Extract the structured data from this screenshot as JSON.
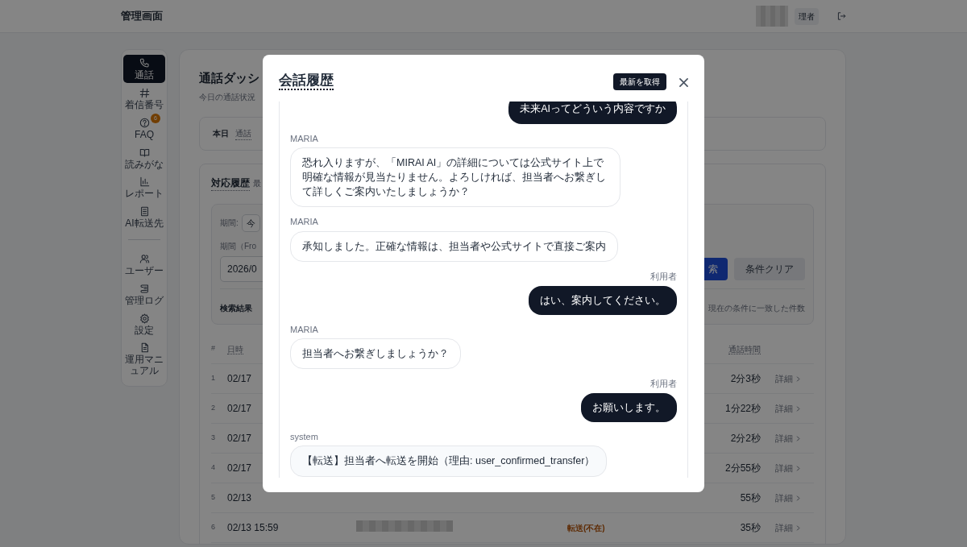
{
  "header": {
    "title": "管理画面",
    "role_badge": "理者"
  },
  "sidebar": {
    "groups": [
      [
        {
          "label": "通話",
          "selected": true
        },
        {
          "label": "着信番号",
          "selected": false
        },
        {
          "label": "FAQ",
          "selected": false,
          "badge": "6"
        },
        {
          "label": "読みがな",
          "selected": false
        },
        {
          "label": "レポート",
          "selected": false
        },
        {
          "label": "AI転送先",
          "selected": false
        }
      ],
      [
        {
          "label": "ユーザー",
          "selected": false
        },
        {
          "label": "管理ログ",
          "selected": false
        },
        {
          "label": "設定",
          "selected": false
        },
        {
          "label": "運用マニュアル",
          "selected": false
        }
      ]
    ]
  },
  "dashboard": {
    "title": "通話ダッシ",
    "subtitle": "今日の通話状況",
    "today": {
      "label": "本日",
      "tab": "通話"
    },
    "history": {
      "title": "対応履歴",
      "note": "最",
      "filter": {
        "period_label": "期間:",
        "period_value": "今",
        "from_label": "期間（Fro",
        "from_value": "2026/0",
        "search_button": "索",
        "clear_button": "条件クリア",
        "result_label": "検索結果",
        "result_note": "現在の条件に一致した件数"
      },
      "table": {
        "columns": [
          "#",
          "日時",
          "通話時間"
        ],
        "rows": [
          {
            "no": "1",
            "datetime": "02/17",
            "duration": "2分3秒",
            "link": "詳細"
          },
          {
            "no": "2",
            "datetime": "02/17",
            "duration": "1分22秒",
            "link": "詳細"
          },
          {
            "no": "3",
            "datetime": "02/17",
            "duration": "2分2秒",
            "link": "詳細"
          },
          {
            "no": "4",
            "datetime": "02/17",
            "duration": "2分55秒",
            "link": "詳細"
          },
          {
            "no": "5",
            "datetime": "02/13",
            "duration": "55秒",
            "link": "詳細"
          },
          {
            "no": "6",
            "datetime": "02/13 15:59",
            "redacted": true,
            "status": "転送(不在)",
            "duration": "35秒",
            "link": "詳細"
          }
        ]
      }
    }
  },
  "modal": {
    "title": "会話履歴",
    "refresh_button": "最新を取得",
    "messages": [
      {
        "kind": "user",
        "text": "未来AIってどういう内容ですか"
      },
      {
        "kind": "assistant",
        "sender": "MARIA",
        "text": "恐れ入りますが、「MIRAI AI」の詳細については公式サイト上で明確な情報が見当たりません。よろしければ、担当者へお繋ぎして詳しくご案内いたしましょうか？"
      },
      {
        "kind": "assistant",
        "sender": "MARIA",
        "text": "承知しました。正確な情報は、担当者や公式サイトで直接ご案内"
      },
      {
        "kind": "user",
        "sender": "利用者",
        "text": "はい、案内してください。"
      },
      {
        "kind": "assistant",
        "sender": "MARIA",
        "text": "担当者へお繋ぎしましょうか？"
      },
      {
        "kind": "user",
        "sender": "利用者",
        "text": "お願いします。"
      },
      {
        "kind": "system",
        "sender": "system",
        "text": "【転送】担当者へ転送を開始（理由: user_confirmed_transfer）"
      }
    ]
  }
}
